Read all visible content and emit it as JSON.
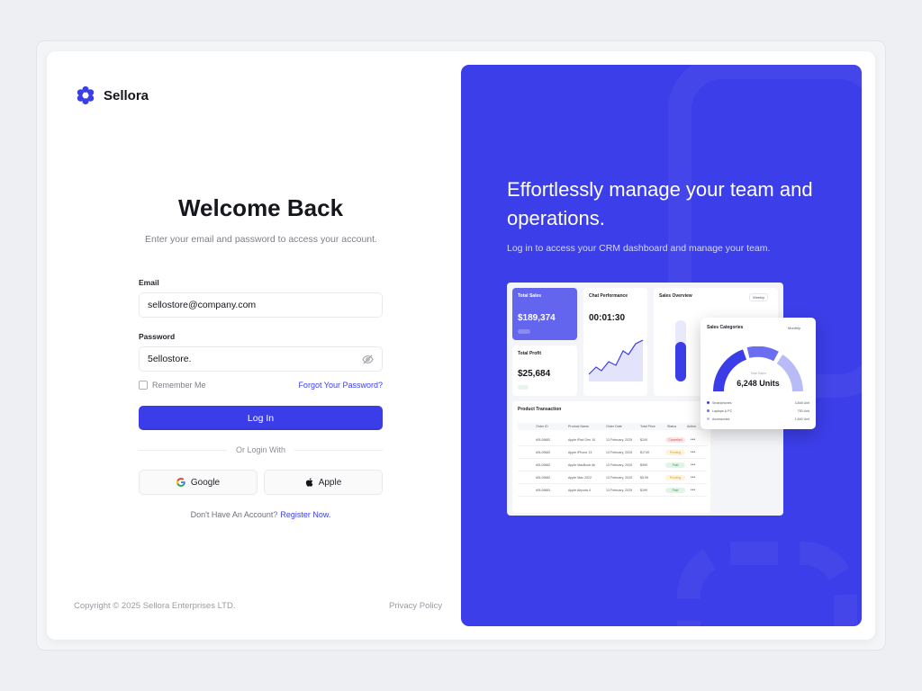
{
  "brand": {
    "name": "Sellora"
  },
  "login": {
    "title": "Welcome Back",
    "subtitle": "Enter your email and password to access your account.",
    "email_label": "Email",
    "email_value": "sellostore@company.com",
    "password_label": "Password",
    "password_value": "5ellostore.",
    "remember_label": "Remember Me",
    "forgot_label": "Forgot Your Password?",
    "login_button": "Log In",
    "divider_text": "Or Login With",
    "google_label": "Google",
    "apple_label": "Apple",
    "no_account_text": "Don't Have An Account?",
    "register_label": "Register Now."
  },
  "footer": {
    "copyright": "Copyright © 2025 Sellora Enterprises LTD.",
    "privacy": "Privacy Policy"
  },
  "hero": {
    "title": "Effortlessly manage your team and operations.",
    "subtitle": "Log in to access your CRM dashboard and manage your team."
  },
  "preview": {
    "total_sales": {
      "title": "Total Sales",
      "value": "$189,374"
    },
    "chat_performance": {
      "title": "Chat Performance",
      "value": "00:01:30"
    },
    "sales_overview": {
      "title": "Sales Overview",
      "filter": "Weekly"
    },
    "total_profit": {
      "title": "Total Profit",
      "value": "$25,684"
    },
    "sales_categories": {
      "title": "Sales Categories",
      "filter": "Monthly",
      "center_label": "Total Sales",
      "center_value": "6,248 Units",
      "items": [
        {
          "name": "Smartphones",
          "value": "3,848 Unit",
          "color": "#3b3ee8"
        },
        {
          "name": "Laptops & PC",
          "value": "750 Unit",
          "color": "#6b6ef0"
        },
        {
          "name": "Accessories",
          "value": "1,640 Unit",
          "color": "#b9bbf7"
        }
      ]
    },
    "transactions": {
      "title": "Product Transaction",
      "columns": [
        "Order ID",
        "Product Name",
        "Order Date",
        "Total Price",
        "Status",
        "Action"
      ],
      "rows": [
        {
          "id": "#SL098821-06",
          "product": "Apple iPad Gen 10",
          "date": "13 February, 2025",
          "price": "$249",
          "status": "Cancelled",
          "status_color": "#e14a4a"
        },
        {
          "id": "#SL098821-04",
          "product": "Apple iPhone 13",
          "date": "13 February, 2025",
          "price": "$1749",
          "status": "Pending",
          "status_color": "#e6a21a"
        },
        {
          "id": "#SL098821-76",
          "product": "Apple MacBook Air M2",
          "date": "13 February, 2025",
          "price": "$999",
          "status": "Paid",
          "status_color": "#2aa64a"
        },
        {
          "id": "#SL098820-99",
          "product": "Apple Mac 2022",
          "date": "13 February, 2025",
          "price": "$5,99",
          "status": "Pending",
          "status_color": "#e6a21a"
        },
        {
          "id": "#SL098817-06",
          "product": "Apple Airpods 4",
          "date": "13 February, 2025",
          "price": "$199",
          "status": "Paid",
          "status_color": "#2aa64a"
        }
      ]
    }
  },
  "colors": {
    "accent": "#3b3ee8",
    "hero_bg": "#3c3ee9",
    "link": "#3a3ee6"
  }
}
